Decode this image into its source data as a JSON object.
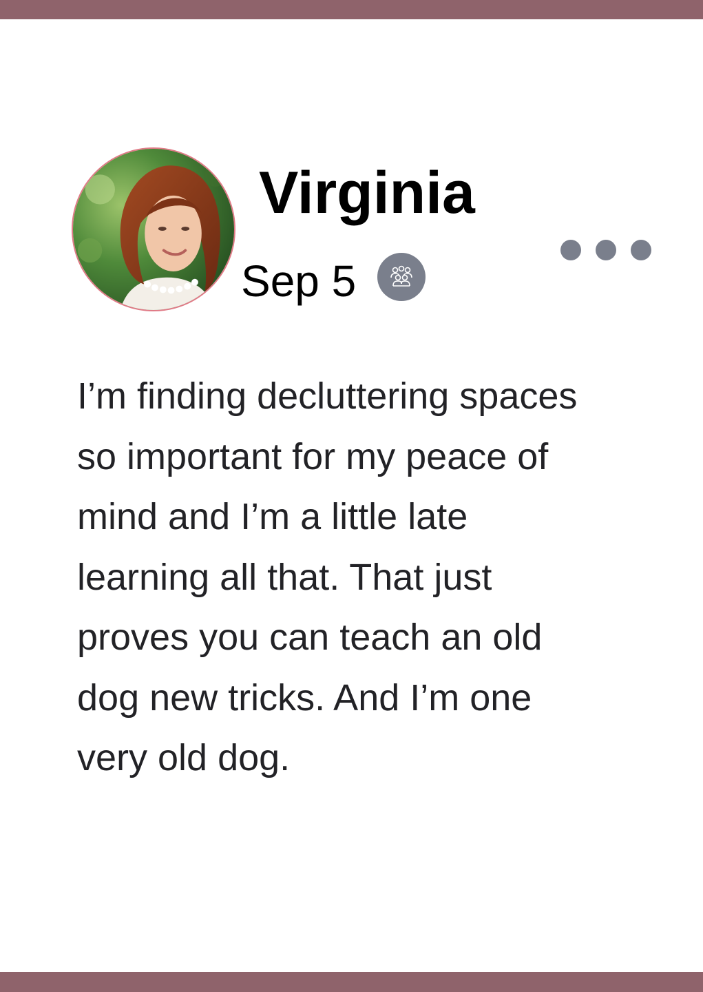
{
  "theme": {
    "frame_color": "#8f636b",
    "icon_gray": "#7a7f8c",
    "avatar_ring": "#e07a86"
  },
  "post": {
    "author": "Virginia",
    "date": "Sep 5",
    "audience_icon": "group-icon",
    "more_icon": "ellipsis-icon",
    "avatar_icon": "profile-photo",
    "body_lines": [
      "I’m finding decluttering spaces",
      "so important for my peace of",
      "mind and I’m a little late",
      "learning all that. That just",
      "proves you can teach an old",
      "dog new tricks. And I’m one",
      "very old dog."
    ]
  }
}
